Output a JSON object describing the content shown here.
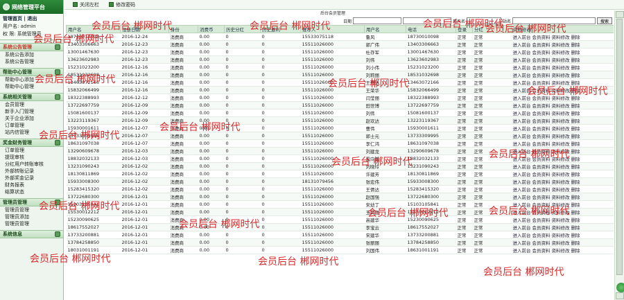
{
  "sidebar": {
    "logo": "网络管理平台",
    "links": "管理首页 | 退出",
    "user": "用户名: admin",
    "role": "权  限: 系统管理员",
    "sections": [
      {
        "title": "系统公告管理",
        "items": [
          "系统公告添加",
          "系统公告管理"
        ]
      },
      {
        "title": "帮助中心管理",
        "items": [
          "帮助中心添加",
          "帮助中心管理"
        ]
      },
      {
        "title": "系统相关管理",
        "items": [
          "会员管理",
          "新手入门管理",
          "关于企业添加",
          "订单管理",
          "站内信管理"
        ]
      },
      {
        "title": "奖金财务管理",
        "items": [
          "订单管理",
          "提现审核",
          "分红用户转账审核",
          "外部转账记录",
          "外部奖金记录",
          "财务报表",
          "结算状态"
        ]
      },
      {
        "title": "管理员管理",
        "items": [
          "管理员管理",
          "管理员添加",
          "管理员管理"
        ]
      },
      {
        "title": "系统信息",
        "items": []
      }
    ]
  },
  "topbar": {
    "close": "关闭左栏",
    "pwd": "修改密码"
  },
  "main": {
    "title": "后台会员管理",
    "date_label": "日期",
    "user_label": "用户名",
    "station_label": "站名",
    "search_btn": "搜索",
    "headers": [
      "用户名",
      "注册日期",
      "身份",
      "消费币",
      "历史分红",
      "历史返利",
      "推荐人",
      "用户名",
      "电话",
      "登录",
      "分红",
      "资料修改"
    ],
    "actions": [
      "进入前台",
      "会员资料",
      "资料修改",
      "删除"
    ],
    "rows": [
      [
        "18730010098",
        "2016-12-24",
        "消费商",
        "0.00",
        "0",
        "0",
        "15533075118",
        "鲁风",
        "18730010098",
        "正常",
        "正常"
      ],
      [
        "13403306663",
        "2016-12-23",
        "消费商",
        "0.00",
        "0",
        "0",
        "15511026000",
        "郭广伟",
        "13403306663",
        "正常",
        "正常"
      ],
      [
        "13001467630",
        "2016-12-23",
        "消费商",
        "0.00",
        "0",
        "0",
        "15511026000",
        "杜存军",
        "13001467630",
        "正常",
        "正常"
      ],
      [
        "13623602983",
        "2016-12-23",
        "消费商",
        "0.00",
        "0",
        "0",
        "15511026000",
        "刘伟",
        "13623602983",
        "正常",
        "正常"
      ],
      [
        "15231023200",
        "2016-12-16",
        "消费商",
        "0.00",
        "0",
        "0",
        "15511026000",
        "刘小伟",
        "15231023200",
        "正常",
        "正常"
      ],
      [
        "18531032698",
        "2016-12-16",
        "消费商",
        "0.00",
        "0",
        "0",
        "15511026000",
        "刘莉丽",
        "18531032698",
        "正常",
        "正常"
      ],
      [
        "13463072166",
        "2016-12-16",
        "消费商",
        "0.00",
        "0",
        "0",
        "15511026000",
        "王倩达",
        "13463072166",
        "正常",
        "正常"
      ],
      [
        "15832066499",
        "2016-12-16",
        "消费商",
        "0.00",
        "0",
        "0",
        "15511026000",
        "王荣华",
        "15832066499",
        "正常",
        "正常"
      ],
      [
        "18322388993",
        "2016-12-12",
        "消费商",
        "0.00",
        "0",
        "0",
        "15511026000",
        "闫莹丽",
        "18322388993",
        "正常",
        "正常"
      ],
      [
        "13722697759",
        "2016-12-09",
        "消费商",
        "0.00",
        "0",
        "0",
        "15511026000",
        "田世博",
        "13722697759",
        "正常",
        "正常"
      ],
      [
        "15081600137",
        "2016-12-09",
        "消费商",
        "0.00",
        "0",
        "0",
        "15511026000",
        "刘伟",
        "15081600137",
        "正常",
        "正常"
      ],
      [
        "13223119367",
        "2016-12-09",
        "消费商",
        "0.00",
        "0",
        "0",
        "15511026000",
        "赵欢达",
        "13223119367",
        "正常",
        "正常"
      ],
      [
        "15930001611",
        "2016-12-07",
        "消费商",
        "0.00",
        "0",
        "0",
        "15511026000",
        "曹伟",
        "15930001611",
        "正常",
        "正常"
      ],
      [
        "13733309995",
        "2016-12-07",
        "消费商",
        "0.00",
        "0",
        "0",
        "15511026000",
        "郭士元",
        "13733309995",
        "正常",
        "正常"
      ],
      [
        "18631097038",
        "2016-12-07",
        "消费商",
        "0.00",
        "0",
        "0",
        "15511026000",
        "李仁鸿",
        "18631097038",
        "正常",
        "正常"
      ],
      [
        "13290609678",
        "2016-12-03",
        "消费商",
        "0.00",
        "0",
        "0",
        "15511026000",
        "刘建龙",
        "13290609678",
        "正常",
        "正常"
      ],
      [
        "18832032133",
        "2016-12-03",
        "消费商",
        "0.00",
        "0",
        "0",
        "15511026000",
        "雷向南",
        "18832032133",
        "正常",
        "正常"
      ],
      [
        "13231090243",
        "2016-12-02",
        "消费商",
        "0.00",
        "0",
        "0",
        "15511026000",
        "刘晓玲",
        "13231090243",
        "正常",
        "正常"
      ],
      [
        "18130811869",
        "2016-12-02",
        "消费商",
        "0.00",
        "0",
        "0",
        "15511026000",
        "许建芳",
        "18130811869",
        "正常",
        "正常"
      ],
      [
        "15933008300",
        "2016-12-02",
        "消费商",
        "0.00",
        "0",
        "0",
        "18131079456",
        "张宏伟",
        "15933008300",
        "正常",
        "正常"
      ],
      [
        "15283415320",
        "2016-12-02",
        "消费商",
        "0.00",
        "0",
        "0",
        "15511026000",
        "王倩达",
        "15283415320",
        "正常",
        "正常"
      ],
      [
        "13722680300",
        "2016-12-01",
        "消费商",
        "0.00",
        "0",
        "0",
        "15511026000",
        "赵国强",
        "13722680300",
        "正常",
        "正常"
      ],
      [
        "15103105841",
        "2016-12-01",
        "消费商",
        "0.00",
        "0",
        "0",
        "15511026000",
        "宋幼丁",
        "15103105841",
        "正常",
        "正常"
      ],
      [
        "15530012212",
        "2016-12-01",
        "消费商",
        "0.00",
        "0",
        "0",
        "15511026000",
        "王凤丽",
        "15530012212",
        "正常",
        "正常"
      ],
      [
        "15230090625",
        "2016-12-01",
        "消费商",
        "0.00",
        "0",
        "0",
        "15511026000",
        "高建华",
        "15230090625",
        "正常",
        "正常"
      ],
      [
        "18617552027",
        "2016-12-01",
        "消费商",
        "0.00",
        "0",
        "0",
        "15511026000",
        "李宝云",
        "18617552027",
        "正常",
        "正常"
      ],
      [
        "13733200881",
        "2016-12-01",
        "消费商",
        "0.00",
        "0",
        "0",
        "15511026000",
        "宋建华",
        "13733200881",
        "正常",
        "正常"
      ],
      [
        "13784258850",
        "2016-12-01",
        "消费商",
        "0.00",
        "0",
        "0",
        "15511026000",
        "张丽丽",
        "13784258850",
        "正常",
        "正常"
      ],
      [
        "18031001191",
        "2016-12-01",
        "消费商",
        "0.00",
        "0",
        "0",
        "15511026000",
        "刘国伟",
        "18631001191",
        "正常",
        "正常"
      ]
    ]
  },
  "watermark_text": "会员后台 郴网时代",
  "colors": {
    "accent": "#2e8b3a",
    "watermark": "#d62b2b"
  }
}
